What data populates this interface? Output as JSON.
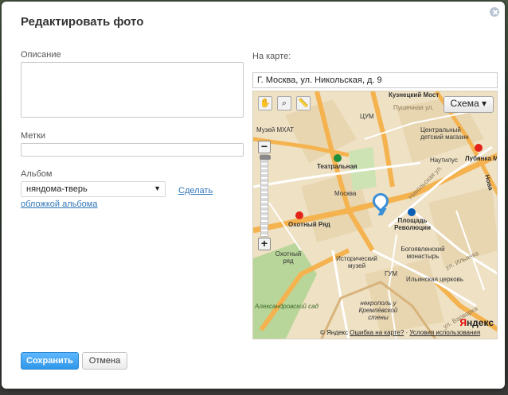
{
  "dialog": {
    "title": "Редактировать фото",
    "close_icon": "close-icon"
  },
  "form": {
    "description_label": "Описание",
    "description_value": "",
    "tags_label": "Метки",
    "tags_value": "",
    "album_label": "Альбом",
    "album_selected": "няндома-тверь",
    "cover_link": "Сделать обложкой альбома"
  },
  "map": {
    "label": "На карте:",
    "address": "Г. Москва, ул. Никольская, д. 9",
    "scheme_button": "Схема ▾",
    "zoom_in": "+",
    "zoom_out": "−",
    "zoom_level_fraction": 0.0,
    "places": {
      "kuznetsky": "Кузнецкий Мост",
      "pushechnaya": "Пушечная ул.",
      "tsum": "ЦУМ",
      "mkhat": "Музей МХАТ",
      "children_store": "Центральный детский магазин",
      "lubyanka": "Лубянка Мет",
      "nautilus": "Наутилус",
      "teatralnaya": "Театральная",
      "moskva": "Москва",
      "nikolskaya": "Никольская ул.",
      "ploshchad_revolyutsii": "Площадь Революции",
      "okhotny_ryad": "Охотный Ряд",
      "okhotny_ryad_mall": "Охотный ряд",
      "historic_museum": "Исторический музей",
      "bogoyavlensky": "Богоявленский монастырь",
      "gum": "ГУМ",
      "ilyinka": "ул. Ильинка",
      "ilyinskaya": "Ильинская церковь",
      "alexander_garden": "Александровский сад",
      "necropolis": "некрополь у Кремлёвской стены",
      "varvarka": "ул. Варварка",
      "novaya": "Нова"
    },
    "yandex_first": "Я",
    "yandex_rest": "ндекс",
    "copyright_prefix": "© Яндекс",
    "error_link": "Ошибка на карте?",
    "terms_link": "Условия использования"
  },
  "buttons": {
    "save": "Сохранить",
    "cancel": "Отмена"
  }
}
